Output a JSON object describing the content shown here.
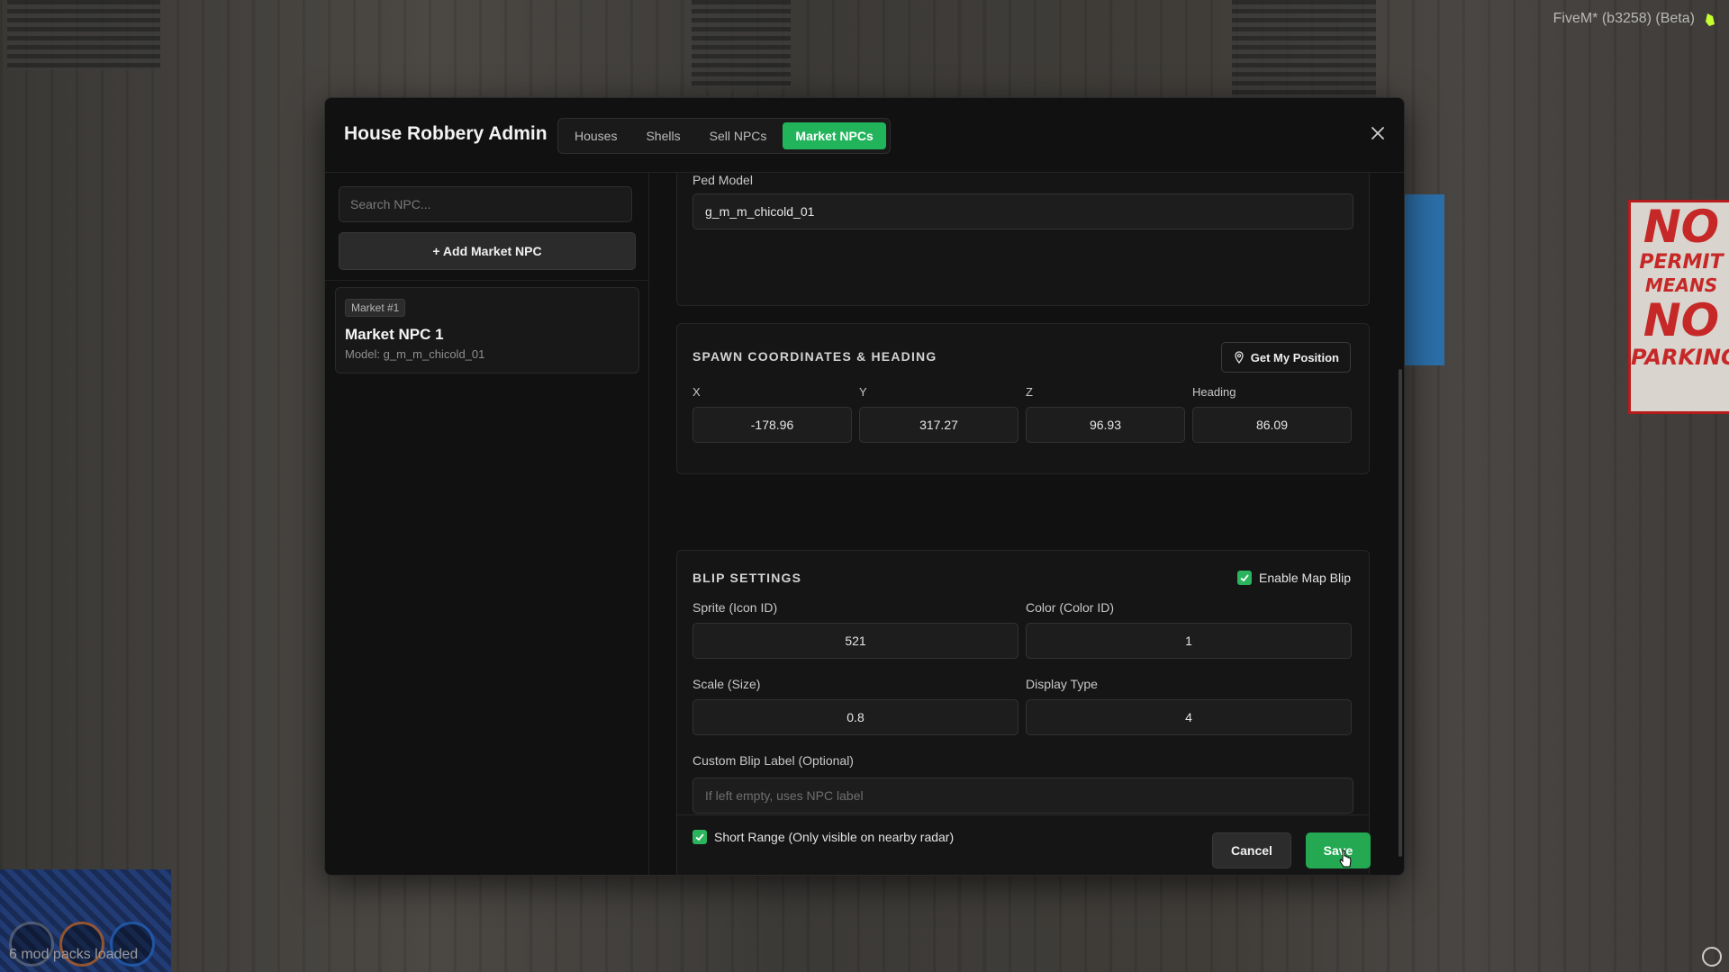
{
  "overlay": {
    "fivem_build": "FiveM* (b3258) (Beta)",
    "mod_status": "6 mod packs loaded"
  },
  "modal": {
    "title": "House Robbery Admin",
    "tabs": [
      {
        "label": "Houses",
        "active": false
      },
      {
        "label": "Shells",
        "active": false
      },
      {
        "label": "Sell NPCs",
        "active": false
      },
      {
        "label": "Market NPCs",
        "active": true
      }
    ]
  },
  "sidebar": {
    "search_placeholder": "Search NPC...",
    "add_button": "+ Add Market NPC",
    "items": [
      {
        "badge": "Market #1",
        "name": "Market NPC 1",
        "model": "Model: g_m_m_chicold_01"
      }
    ]
  },
  "ped": {
    "label": "Ped Model",
    "value": "g_m_m_chicold_01"
  },
  "spawn": {
    "title": "SPAWN COORDINATES & HEADING",
    "get_position": "Get My Position",
    "x_label": "X",
    "x": "-178.96",
    "y_label": "Y",
    "y": "317.27",
    "z_label": "Z",
    "z": "96.93",
    "heading_label": "Heading",
    "heading": "86.09"
  },
  "blip": {
    "title": "BLIP SETTINGS",
    "enable_label": "Enable Map Blip",
    "enable_checked": true,
    "sprite_label": "Sprite (Icon ID)",
    "sprite": "521",
    "color_label": "Color (Color ID)",
    "color": "1",
    "scale_label": "Scale (Size)",
    "scale": "0.8",
    "display_label": "Display Type",
    "display": "4",
    "custom_label": "Custom Blip Label (Optional)",
    "custom_placeholder": "If left empty, uses NPC label",
    "short_range_label": "Short Range (Only visible on nearby radar)",
    "short_range_checked": true
  },
  "footer": {
    "cancel": "Cancel",
    "save": "Save"
  },
  "colors": {
    "accent": "#21b45b",
    "panel": "#111111",
    "sign_red": "#c62828"
  },
  "background_sign": [
    "NO",
    "PERMIT",
    "MEANS",
    "NO",
    "PARKING"
  ]
}
